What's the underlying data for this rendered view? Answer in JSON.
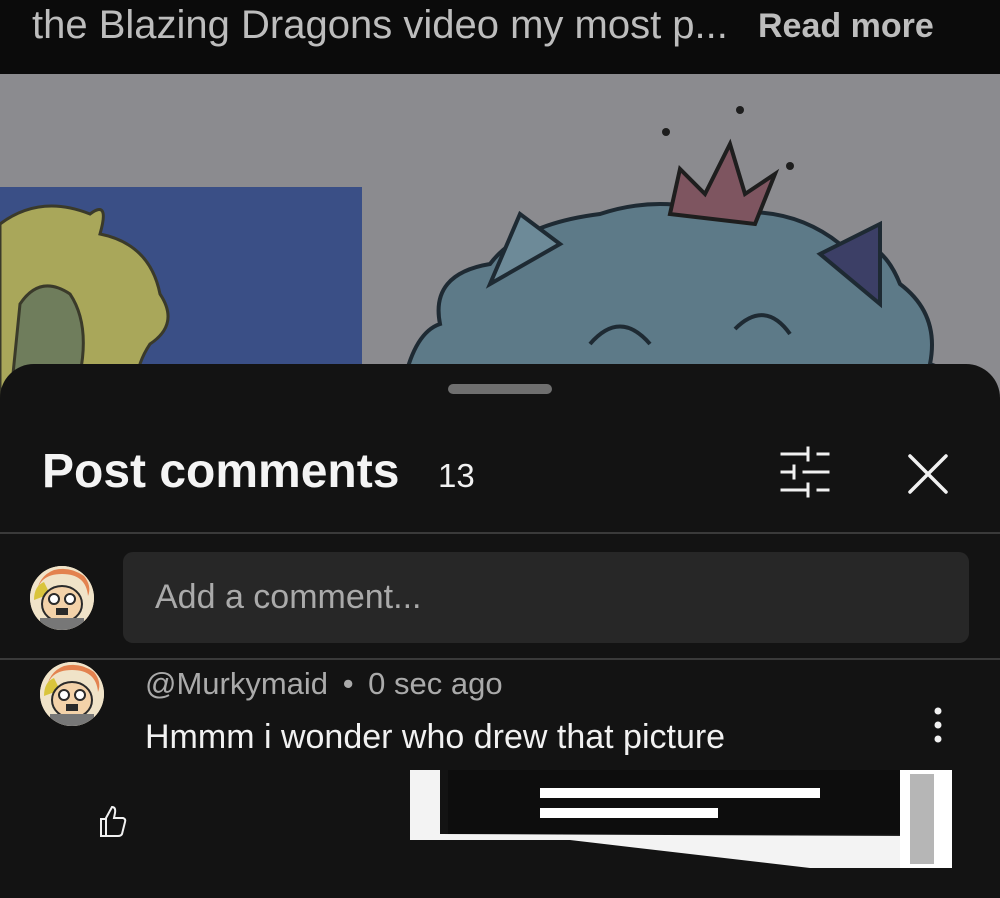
{
  "description": {
    "text": "the Blazing Dragons video my most p...",
    "read_more": "Read more"
  },
  "sheet": {
    "title": "Post comments",
    "count": "13",
    "filter_icon": "sliders-icon",
    "close_icon": "close-icon"
  },
  "composer": {
    "placeholder": "Add a comment..."
  },
  "comments": [
    {
      "author": "@Murkymaid",
      "separator": "•",
      "time": "0 sec ago",
      "text": "Hmmm i wonder who drew that picture",
      "like_icon": "thumbs-up-icon",
      "menu_icon": "more-vertical-icon"
    }
  ],
  "colors": {
    "sheet_bg": "#131313",
    "input_bg": "#272727",
    "secondary_text": "#aaaaaa",
    "primary_text": "#f1f1f1"
  }
}
